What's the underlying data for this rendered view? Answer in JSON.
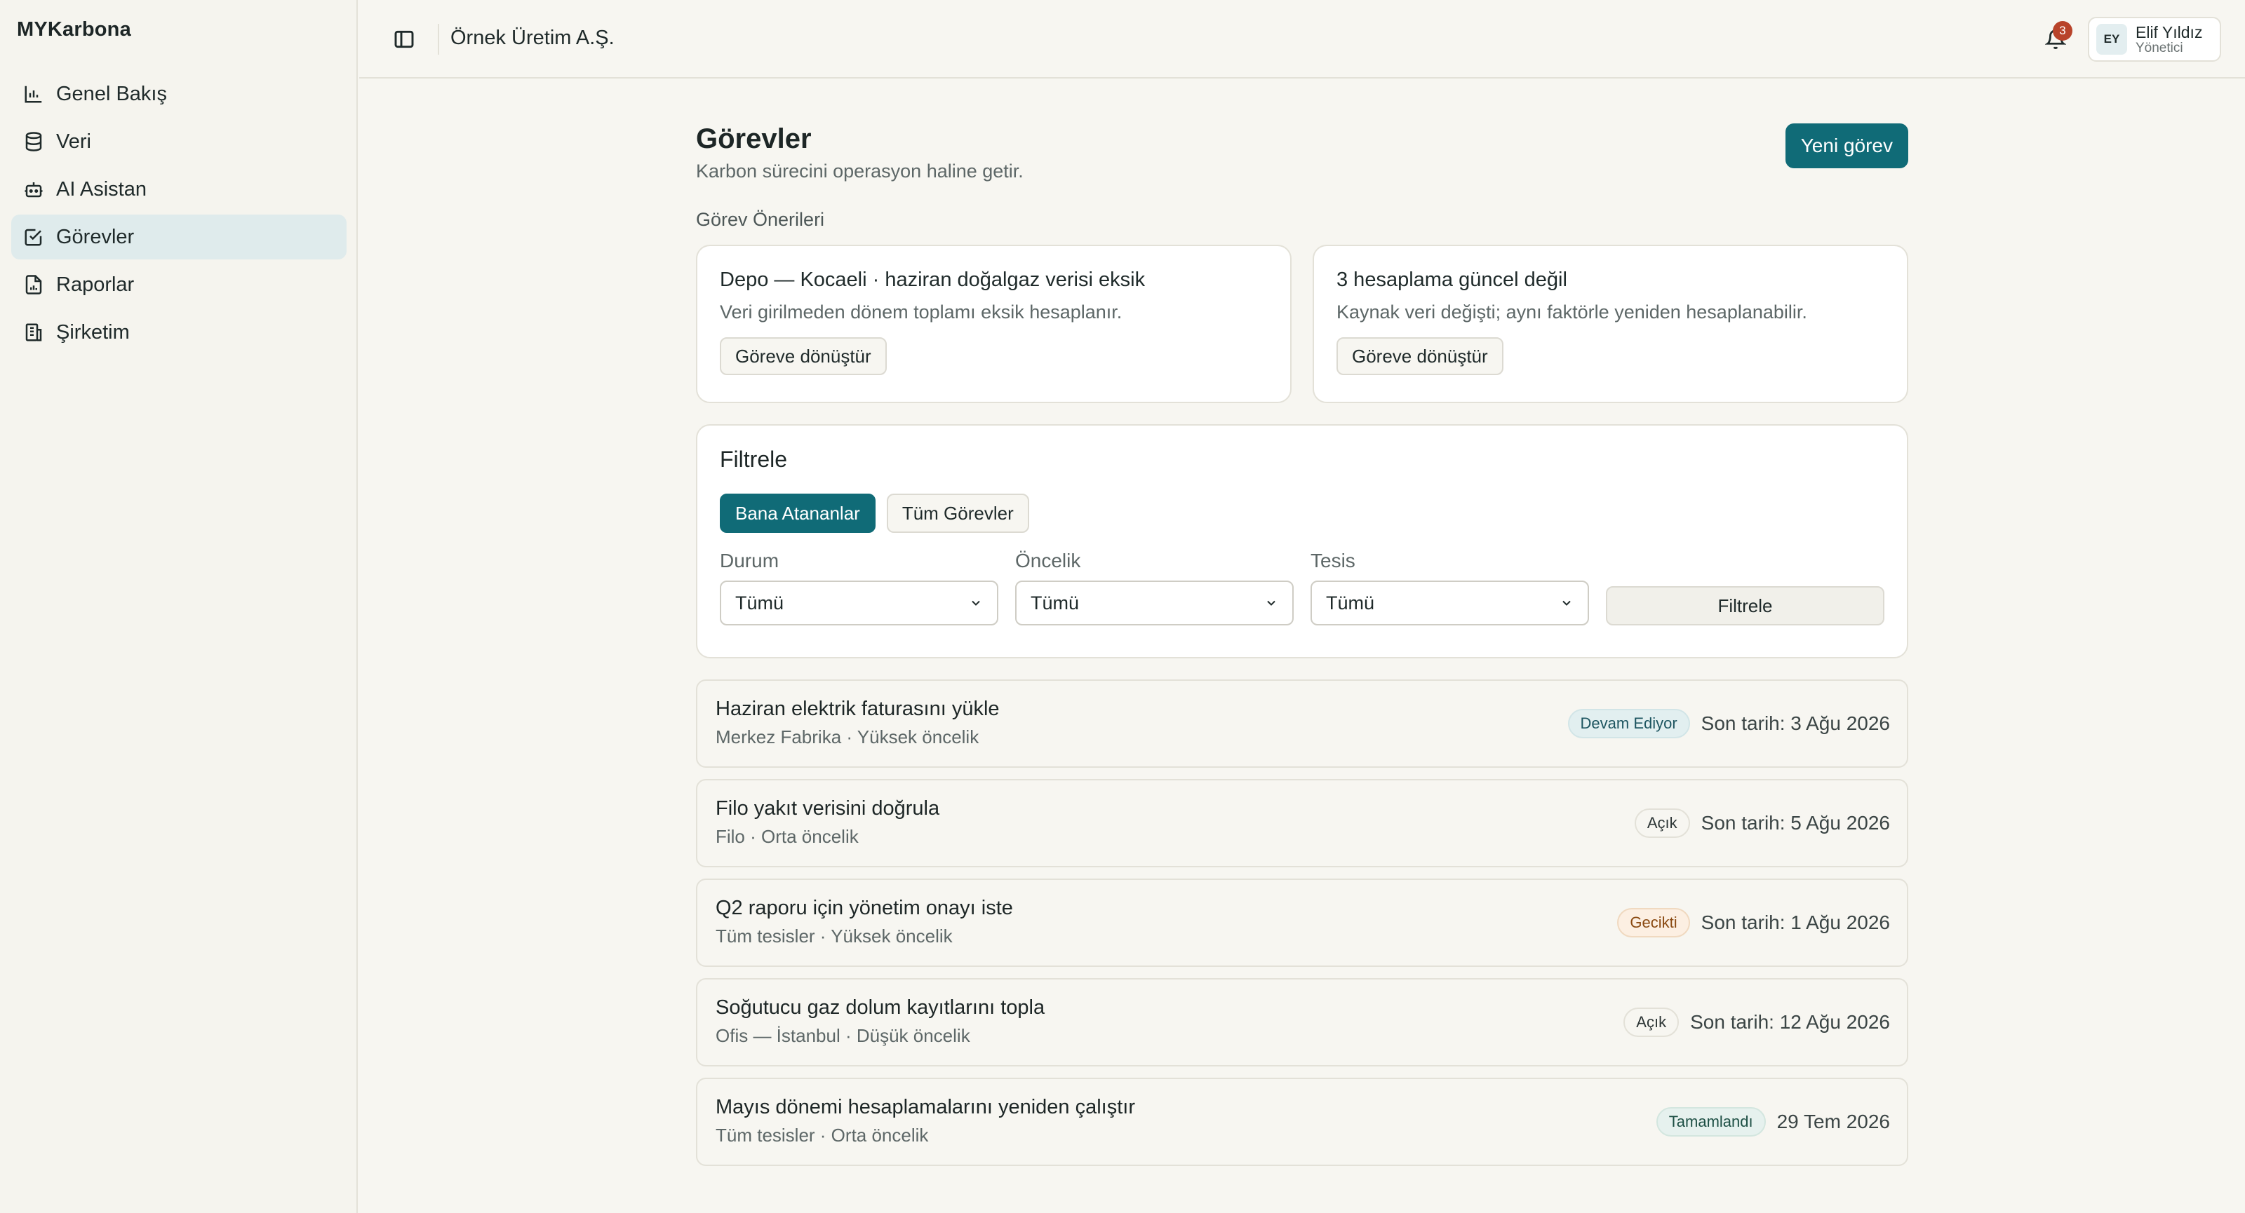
{
  "app": {
    "brand": "MYKarbona"
  },
  "sidebar": {
    "items": [
      {
        "label": "Genel Bakış",
        "icon": "bar-chart-icon",
        "active": false
      },
      {
        "label": "Veri",
        "icon": "database-icon",
        "active": false
      },
      {
        "label": "AI Asistan",
        "icon": "robot-icon",
        "active": false
      },
      {
        "label": "Görevler",
        "icon": "checkbox-icon",
        "active": true
      },
      {
        "label": "Raporlar",
        "icon": "report-icon",
        "active": false
      },
      {
        "label": "Şirketim",
        "icon": "building-icon",
        "active": false
      }
    ]
  },
  "header": {
    "company": "Örnek Üretim A.Ş.",
    "notifications": "3",
    "user": {
      "initials": "EY",
      "name": "Elif Yıldız",
      "role": "Yönetici"
    }
  },
  "page": {
    "title": "Görevler",
    "subtitle": "Karbon sürecini operasyon haline getir.",
    "new_button": "Yeni görev",
    "suggestions_label": "Görev Önerileri",
    "suggestions": [
      {
        "title": "Depo — Kocaeli · haziran doğalgaz verisi eksik",
        "desc": "Veri girilmeden dönem toplamı eksik hesaplanır.",
        "button": "Göreve dönüştür"
      },
      {
        "title": "3 hesaplama güncel değil",
        "desc": "Kaynak veri değişti; aynı faktörle yeniden hesaplanabilir.",
        "button": "Göreve dönüştür"
      }
    ],
    "filter": {
      "title": "Filtrele",
      "segments": [
        {
          "label": "Bana Atananlar",
          "active": true
        },
        {
          "label": "Tüm Görevler",
          "active": false
        }
      ],
      "status_label": "Durum",
      "status_value": "Tümü",
      "priority_label": "Öncelik",
      "priority_value": "Tümü",
      "facility_label": "Tesis",
      "facility_value": "Tümü",
      "apply_button": "Filtrele"
    },
    "tasks": [
      {
        "title": "Haziran elektrik faturasını yükle",
        "meta": "Merkez Fabrika · Yüksek öncelik",
        "status": "Devam Ediyor",
        "status_kind": "progress",
        "due": "Son tarih: 3 Ağu 2026"
      },
      {
        "title": "Filo yakıt verisini doğrula",
        "meta": "Filo · Orta öncelik",
        "status": "Açık",
        "status_kind": "open",
        "due": "Son tarih: 5 Ağu 2026"
      },
      {
        "title": "Q2 raporu için yönetim onayı iste",
        "meta": "Tüm tesisler · Yüksek öncelik",
        "status": "Gecikti",
        "status_kind": "late",
        "due": "Son tarih: 1 Ağu 2026"
      },
      {
        "title": "Soğutucu gaz dolum kayıtlarını topla",
        "meta": "Ofis — İstanbul · Düşük öncelik",
        "status": "Açık",
        "status_kind": "open",
        "due": "Son tarih: 12 Ağu 2026"
      },
      {
        "title": "Mayıs dönemi hesaplamalarını yeniden çalıştır",
        "meta": "Tüm tesisler · Orta öncelik",
        "status": "Tamamlandı",
        "status_kind": "done",
        "due": "29 Tem 2026"
      }
    ]
  },
  "colors": {
    "accent": "#106b77",
    "late": "#8a4a12",
    "badge_red": "#b8432a"
  }
}
